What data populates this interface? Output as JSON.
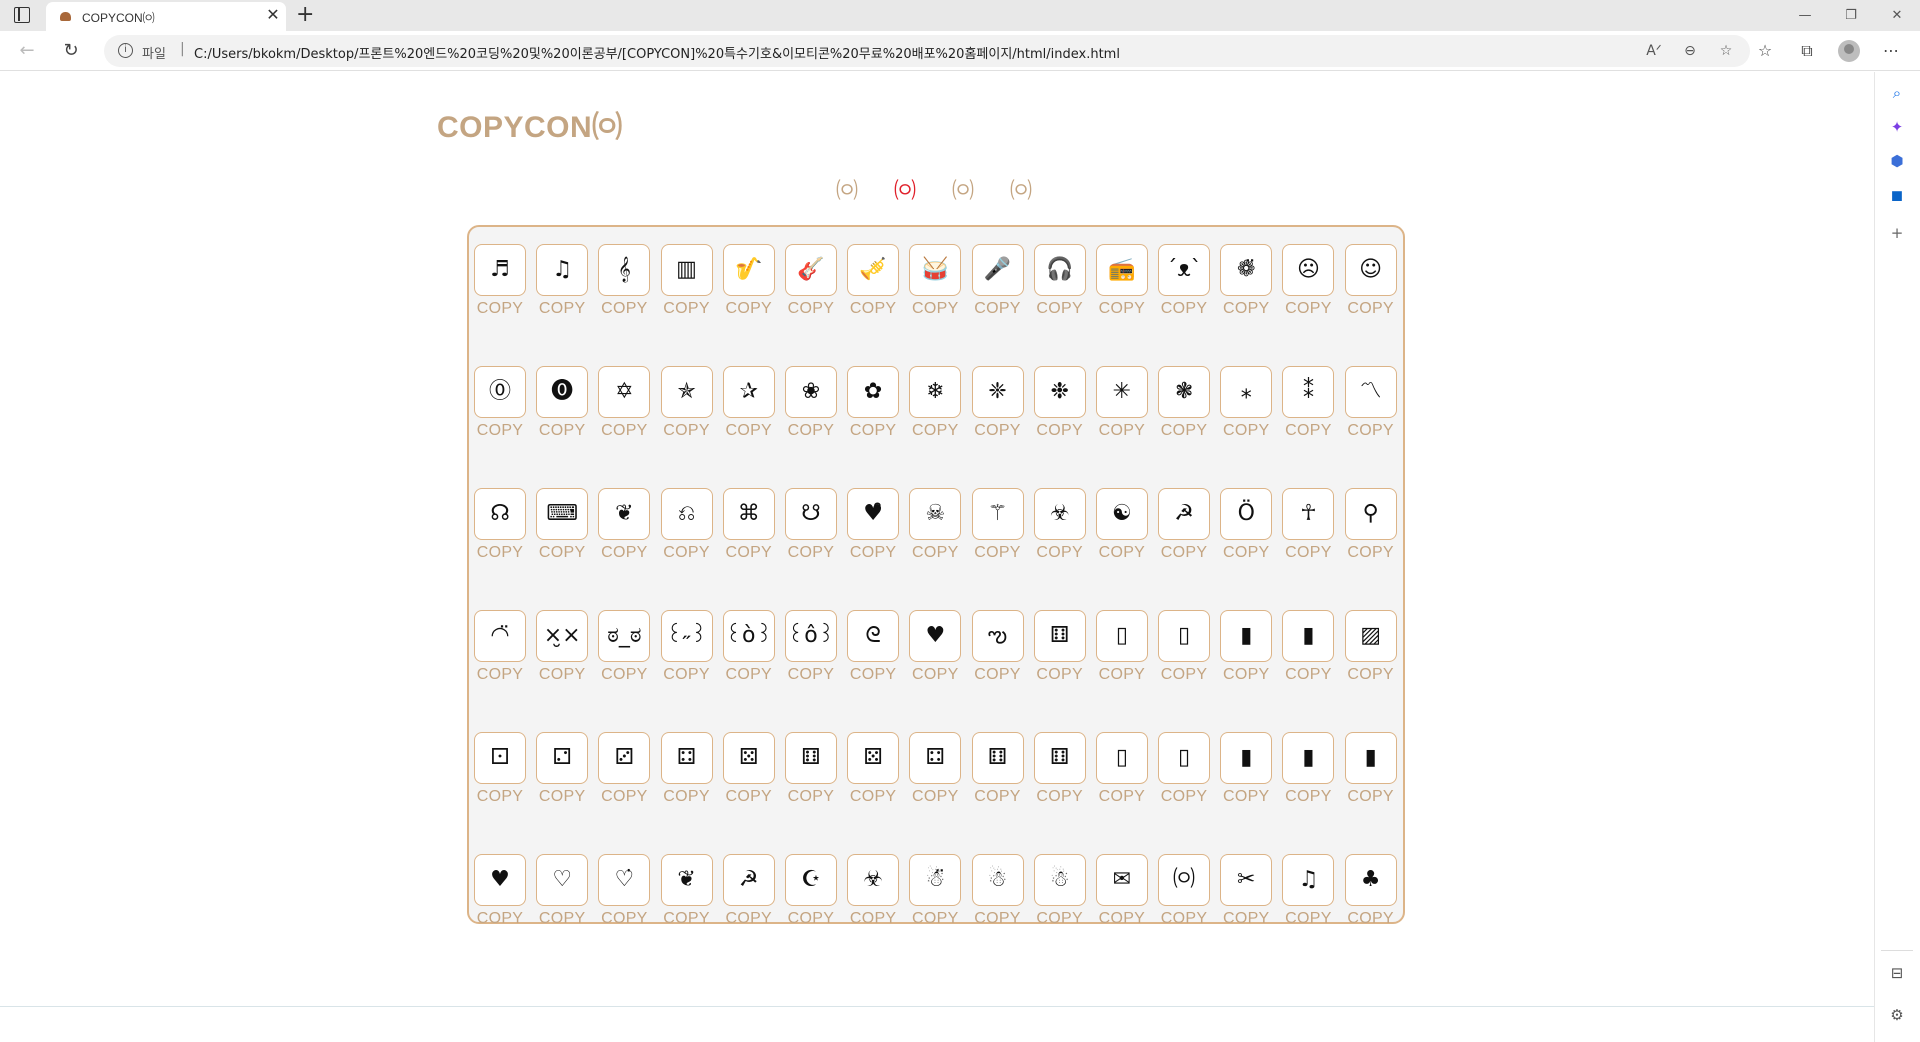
{
  "browser": {
    "tab_title": "COPYCON㈇",
    "new_tab": "+",
    "close": "✕",
    "address_scheme": "파일",
    "address_separator": "|",
    "address_url": "C:/Users/bkokm/Desktop/프론트%20엔드%20코딩%20및%20이론공부/[COPYCON]%20특수기호&이모티콘%20무료%20배포%20홈페이지/html/index.html",
    "info_icon": "i"
  },
  "page": {
    "logo": "COPYCON㈇",
    "category_tabs": [
      "㈇",
      "㈇",
      "㈇",
      "㈇"
    ],
    "active_tab_index": 1,
    "copy_label": "COPY",
    "symbols": [
      "♬",
      "♫",
      "𝄞",
      "▥",
      "🎷",
      "🎸",
      "🎺",
      "🥁",
      "🎤",
      "🎧",
      "📻",
      "´ᴥ`",
      "❁̈",
      "☹",
      "☺",
      "⓪",
      "⓿",
      "✡",
      "✯",
      "✰",
      "❀",
      "✿",
      "❄",
      "❈",
      "❉",
      "✳",
      "❃",
      "⁎",
      "⁑",
      "〽",
      "☊",
      "⌨",
      "❦",
      "⎌",
      "⌘",
      "☋",
      "♥̑",
      "☠",
      "⚚",
      "☣",
      "☯",
      "☭",
      "Ö",
      "☥",
      "⚲",
      "◠̈",
      "×̮×",
      "ಠ_ಠ",
      "꒰˶꒱",
      "꒰ò꒱",
      "꒰ô꒱",
      "ᘓ",
      "♥",
      "ఌ",
      "⚅",
      "▯",
      "▯",
      "▮",
      "▮",
      "▨",
      "⚀",
      "⚁",
      "⚂",
      "⚃",
      "⚄",
      "⚅",
      "⚄",
      "⚃",
      "⚅",
      "⚅",
      "▯",
      "▯",
      "▮",
      "▮",
      "▮",
      "♥",
      "♡",
      "♡̇",
      "❦",
      "☭",
      "☪",
      "☣",
      "☃̈",
      "☃",
      "☃",
      "✉",
      "㈇",
      "✂",
      "♫",
      "♣"
    ]
  },
  "colors": {
    "accent": "#c4a582",
    "border": "#dcb488",
    "active_tab": "#e0202a",
    "panel_bg": "#f4f4f4"
  }
}
